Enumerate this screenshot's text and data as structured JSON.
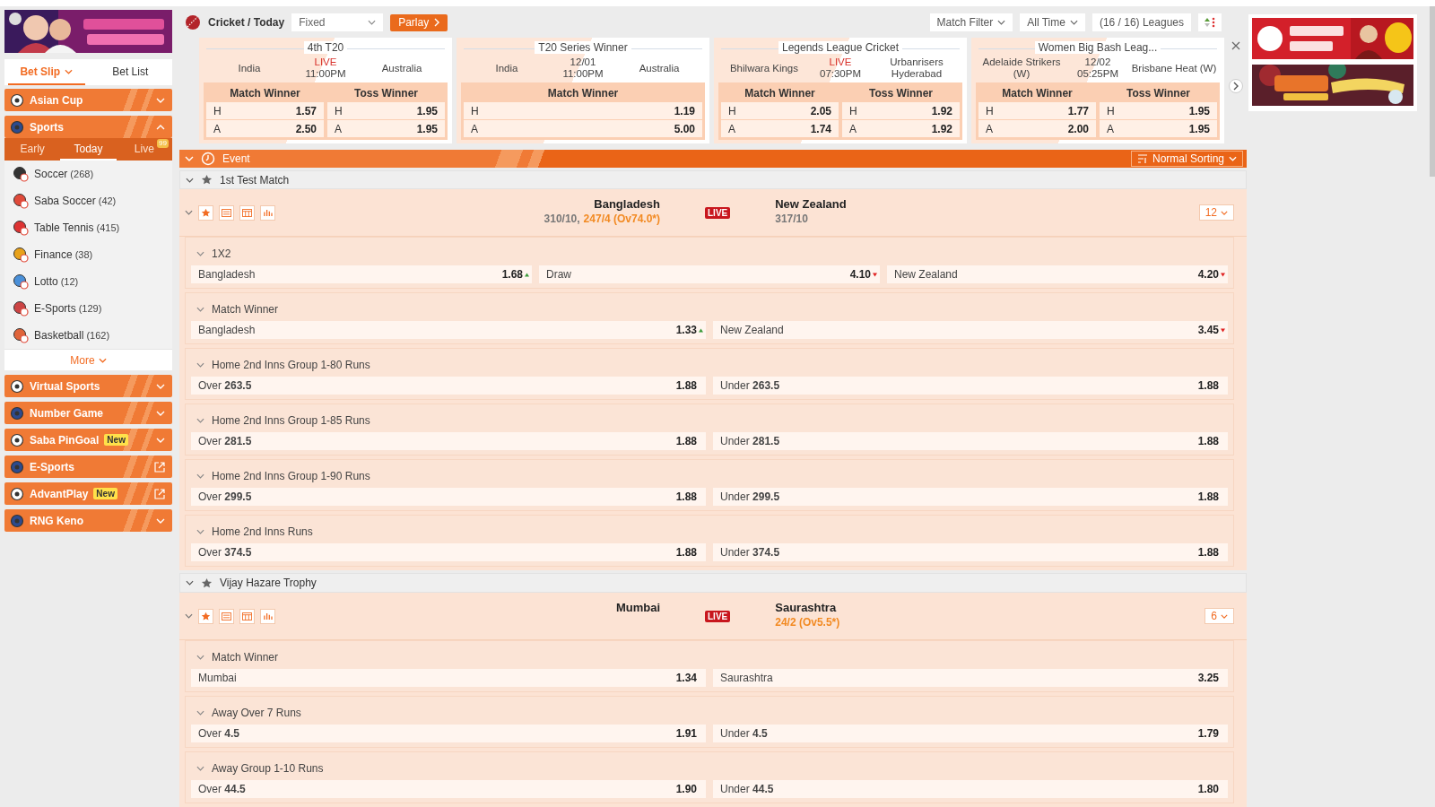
{
  "sidebar": {
    "tabs": [
      {
        "label": "Bet Slip",
        "selected": true
      },
      {
        "label": "Bet List",
        "selected": false
      }
    ],
    "sections": [
      {
        "label": "Asian Cup",
        "expanded": false,
        "kind": "chevron"
      },
      {
        "label": "Sports",
        "expanded": true,
        "kind": "chevron",
        "subtabs": [
          {
            "label": "Early",
            "selected": false
          },
          {
            "label": "Today",
            "selected": true
          },
          {
            "label": "Live",
            "selected": false,
            "badge": "99"
          }
        ],
        "items": [
          {
            "name": "Soccer",
            "count": "(268)"
          },
          {
            "name": "Saba Soccer",
            "count": "(42)"
          },
          {
            "name": "Table Tennis",
            "count": "(415)"
          },
          {
            "name": "Finance",
            "count": "(38)"
          },
          {
            "name": "Lotto",
            "count": "(12)"
          },
          {
            "name": "E-Sports",
            "count": "(129)"
          },
          {
            "name": "Basketball",
            "count": "(162)"
          }
        ],
        "more": "More"
      },
      {
        "label": "Virtual Sports",
        "expanded": false,
        "kind": "chevron"
      },
      {
        "label": "Number Game",
        "expanded": false,
        "kind": "chevron"
      },
      {
        "label": "Saba PinGoal",
        "badge": "New",
        "expanded": false,
        "kind": "chevron"
      },
      {
        "label": "E-Sports",
        "kind": "external"
      },
      {
        "label": "AdvantPlay",
        "badge": "New",
        "kind": "external"
      },
      {
        "label": "RNG Keno",
        "expanded": false,
        "kind": "chevron"
      }
    ]
  },
  "toolbar": {
    "title": "Cricket / Today",
    "odds_type": "Fixed",
    "parlay": "Parlay",
    "filters": [
      "Match Filter",
      "All Time"
    ],
    "leagues": "(16 / 16) Leagues"
  },
  "featured": [
    {
      "title": "4th T20",
      "home": "India",
      "away": "Australia",
      "live": true,
      "status": "LIVE",
      "time": "11:00PM",
      "markets": [
        {
          "name": "Match Winner",
          "rows": [
            {
              "side": "H",
              "odds": "1.57"
            },
            {
              "side": "A",
              "odds": "2.50"
            }
          ]
        },
        {
          "name": "Toss Winner",
          "rows": [
            {
              "side": "H",
              "odds": "1.95"
            },
            {
              "side": "A",
              "odds": "1.95"
            }
          ]
        }
      ]
    },
    {
      "title": "T20 Series Winner",
      "home": "India",
      "away": "Australia",
      "live": false,
      "status": "12/01",
      "time": "11:00PM",
      "markets": [
        {
          "name": "Match Winner",
          "rows": [
            {
              "side": "H",
              "odds": "1.19"
            },
            {
              "side": "A",
              "odds": "5.00"
            }
          ]
        }
      ]
    },
    {
      "title": "Legends League Cricket",
      "home": "Bhilwara Kings",
      "away": "Urbanrisers Hyderabad",
      "live": true,
      "status": "LIVE",
      "time": "07:30PM",
      "markets": [
        {
          "name": "Match Winner",
          "rows": [
            {
              "side": "H",
              "odds": "2.05"
            },
            {
              "side": "A",
              "odds": "1.74"
            }
          ]
        },
        {
          "name": "Toss Winner",
          "rows": [
            {
              "side": "H",
              "odds": "1.92"
            },
            {
              "side": "A",
              "odds": "1.92"
            }
          ]
        }
      ]
    },
    {
      "title": "Women Big Bash Leag...",
      "home": "Adelaide Strikers (W)",
      "away": "Brisbane Heat (W)",
      "live": false,
      "status": "12/02",
      "time": "05:25PM",
      "markets": [
        {
          "name": "Match Winner",
          "rows": [
            {
              "side": "H",
              "odds": "1.77"
            },
            {
              "side": "A",
              "odds": "2.00"
            }
          ]
        },
        {
          "name": "Toss Winner",
          "rows": [
            {
              "side": "H",
              "odds": "1.95"
            },
            {
              "side": "A",
              "odds": "1.95"
            }
          ]
        }
      ]
    }
  ],
  "events": {
    "title": "Event",
    "sorting": "Normal Sorting",
    "leagues": [
      {
        "name": "1st Test Match",
        "match": {
          "home": "Bangladesh",
          "away": "New Zealand",
          "live_label": "LIVE",
          "home_score": [
            {
              "text": "310/10,",
              "live": false
            },
            {
              "text": "247/4 (Ov74.0*)",
              "live": true
            }
          ],
          "away_score": [
            {
              "text": "317/10",
              "live": false
            }
          ],
          "market_count": "12",
          "markets": [
            {
              "name": "1X2",
              "selections": [
                {
                  "label": "Bangladesh",
                  "odds": "1.68",
                  "kind": "up"
                },
                {
                  "label": "Draw",
                  "odds": "4.10",
                  "kind": "down"
                },
                {
                  "label": "New Zealand",
                  "odds": "4.20",
                  "kind": "down"
                }
              ]
            },
            {
              "name": "Match Winner",
              "selections": [
                {
                  "label": "Bangladesh",
                  "odds": "1.33",
                  "kind": "up"
                },
                {
                  "label": "New Zealand",
                  "odds": "3.45",
                  "kind": "down"
                }
              ]
            },
            {
              "name": "Home 2nd Inns Group 1-80 Runs",
              "selections": [
                {
                  "label": "Over **263.5**",
                  "odds": "1.88"
                },
                {
                  "label": "Under **263.5**",
                  "odds": "1.88"
                }
              ]
            },
            {
              "name": "Home 2nd Inns Group 1-85 Runs",
              "selections": [
                {
                  "label": "Over **281.5**",
                  "odds": "1.88"
                },
                {
                  "label": "Under **281.5**",
                  "odds": "1.88"
                }
              ]
            },
            {
              "name": "Home 2nd Inns Group 1-90 Runs",
              "selections": [
                {
                  "label": "Over **299.5**",
                  "odds": "1.88"
                },
                {
                  "label": "Under **299.5**",
                  "odds": "1.88"
                }
              ]
            },
            {
              "name": "Home 2nd Inns Runs",
              "selections": [
                {
                  "label": "Over **374.5**",
                  "odds": "1.88"
                },
                {
                  "label": "Under **374.5**",
                  "odds": "1.88"
                }
              ]
            }
          ]
        }
      },
      {
        "name": "Vijay Hazare Trophy",
        "match": {
          "home": "Mumbai",
          "away": "Saurashtra",
          "live_label": "LIVE",
          "away_score": [
            {
              "text": "24/2 (Ov5.5*)",
              "live": true
            }
          ],
          "market_count": "6",
          "markets": [
            {
              "name": "Match Winner",
              "selections": [
                {
                  "label": "Mumbai",
                  "odds": "1.34"
                },
                {
                  "label": "Saurashtra",
                  "odds": "3.25"
                }
              ]
            },
            {
              "name": "Away Over 7 Runs",
              "selections": [
                {
                  "label": "Over **4.5**",
                  "odds": "1.91"
                },
                {
                  "label": "Under **4.5**",
                  "odds": "1.79"
                }
              ]
            },
            {
              "name": "Away Group 1-10 Runs",
              "selections": [
                {
                  "label": "Over **44.5**",
                  "odds": "1.90"
                },
                {
                  "label": "Under **44.5**",
                  "odds": "1.80"
                }
              ]
            }
          ]
        }
      }
    ]
  }
}
